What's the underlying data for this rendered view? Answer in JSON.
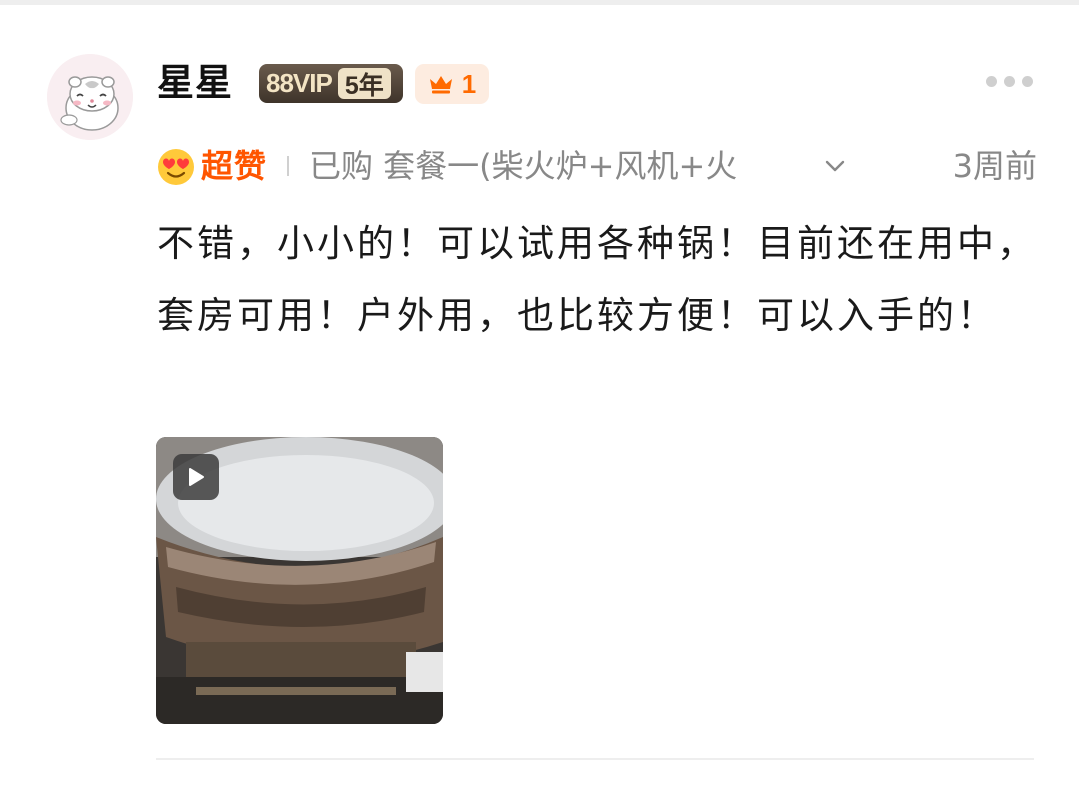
{
  "user": {
    "name": "星星",
    "vip_label": "88VIP",
    "vip_years": "5年",
    "level_count": "1"
  },
  "review": {
    "rating_label": "超赞",
    "purchase_info": "已购 套餐一(柴火炉+风机+火",
    "time_ago": "3周前",
    "text": "不错，小小的！可以试用各种锅！目前还在用中，套房可用！户外用，也比较方便！可以入手的！"
  },
  "media": {
    "type": "video"
  },
  "icons": {
    "more": "more-dots-icon",
    "expand": "chevron-down-icon",
    "rating": "heart-eyes-emoji-icon",
    "level": "crown-icon",
    "play": "play-icon"
  },
  "colors": {
    "accent_orange": "#ff5500",
    "crown_orange": "#ff6a00",
    "vip_dark": "#4a3f34",
    "vip_gold": "#efe2c7",
    "muted_text": "#888888"
  }
}
